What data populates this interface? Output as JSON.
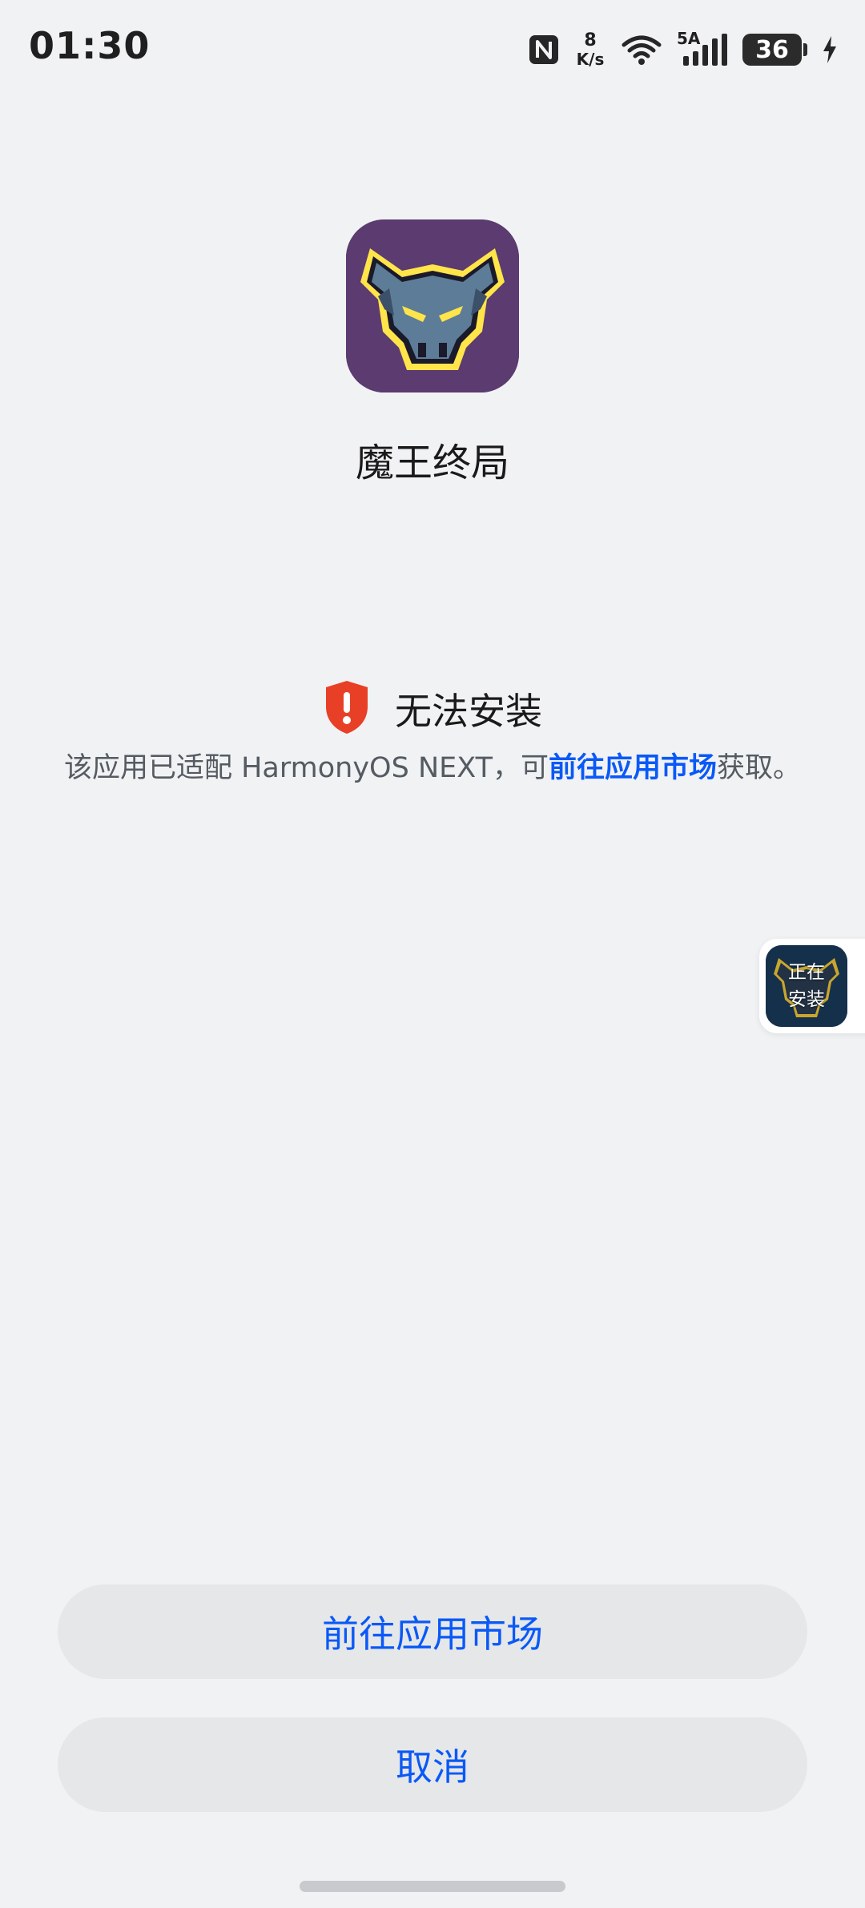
{
  "status_bar": {
    "time": "01:30",
    "net_speed_value": "8",
    "net_speed_unit": "K/s",
    "network_label": "5A",
    "battery_percent": "36"
  },
  "app": {
    "name": "魔王终局",
    "icon": "demon-skull-icon"
  },
  "error": {
    "title": "无法安装",
    "desc_prefix": "该应用已适配 HarmonyOS NEXT，可",
    "desc_link": "前往应用市场",
    "desc_suffix": "获取。",
    "icon": "warning-shield-icon",
    "color": "#e84026"
  },
  "floating": {
    "line1": "正在",
    "line2": "安装"
  },
  "buttons": {
    "go_market": "前往应用市场",
    "cancel": "取消"
  },
  "colors": {
    "accent": "#0a59f7",
    "background": "#f1f2f4",
    "button_bg": "#e6e7e9"
  }
}
